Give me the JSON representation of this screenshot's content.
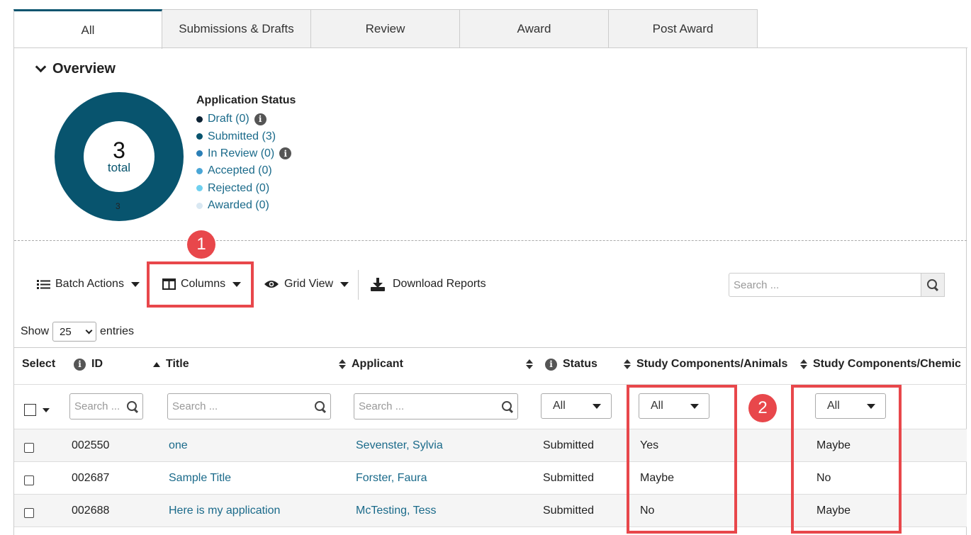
{
  "tabs": [
    "All",
    "Submissions & Drafts",
    "Review",
    "Award",
    "Post Award"
  ],
  "overview": {
    "title": "Overview",
    "total": "3",
    "total_label": "total",
    "segment_label": "3",
    "legend_title": "Application Status",
    "legend": [
      {
        "label": "Draft (0)",
        "color": "#0d2233",
        "info": true
      },
      {
        "label": "Submitted (3)",
        "color": "#08546e",
        "info": false
      },
      {
        "label": "In Review (0)",
        "color": "#2b7fb6",
        "info": true
      },
      {
        "label": "Accepted (0)",
        "color": "#4aa6d6",
        "info": false
      },
      {
        "label": "Rejected (0)",
        "color": "#6fd0ef",
        "info": false
      },
      {
        "label": "Awarded (0)",
        "color": "#d9e8f2",
        "info": false
      }
    ]
  },
  "toolbar": {
    "batch_actions": "Batch Actions",
    "columns": "Columns",
    "grid_view": "Grid View",
    "download_reports": "Download Reports",
    "search_placeholder": "Search ..."
  },
  "show": {
    "prefix": "Show",
    "value": "25",
    "suffix": "entries"
  },
  "table": {
    "headers": [
      "Select",
      "ID",
      "Title",
      "Applicant",
      "Status",
      "Study Components/Animals",
      "Study Components/Chemic"
    ],
    "filter_placeholder": "Search ...",
    "filter_all": "All",
    "rows": [
      {
        "id": "002550",
        "title": "one",
        "applicant": "Sevenster, Sylvia",
        "status": "Submitted",
        "animals": "Yes",
        "chem": "Maybe"
      },
      {
        "id": "002687",
        "title": "Sample Title",
        "applicant": "Forster, Faura",
        "status": "Submitted",
        "animals": "Maybe",
        "chem": "No"
      },
      {
        "id": "002688",
        "title": "Here is my application",
        "applicant": "McTesting, Tess",
        "status": "Submitted",
        "animals": "No",
        "chem": "Maybe"
      }
    ]
  },
  "annotations": {
    "badge1": "1",
    "badge2": "2",
    "color": "#e8474b"
  }
}
